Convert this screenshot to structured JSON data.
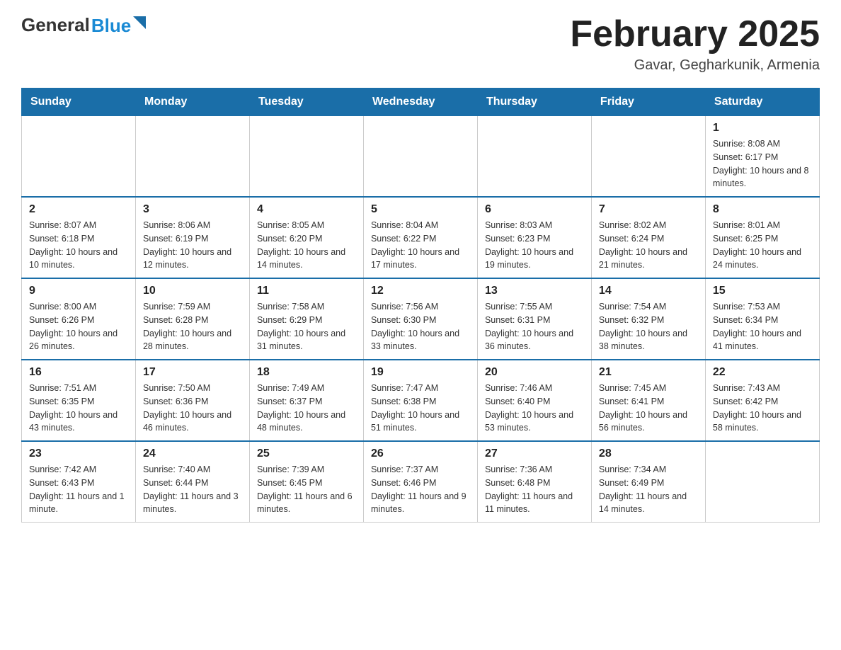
{
  "logo": {
    "general": "General",
    "blue": "Blue"
  },
  "title": "February 2025",
  "subtitle": "Gavar, Gegharkunik, Armenia",
  "days_of_week": [
    "Sunday",
    "Monday",
    "Tuesday",
    "Wednesday",
    "Thursday",
    "Friday",
    "Saturday"
  ],
  "weeks": [
    {
      "days": [
        {
          "number": "",
          "info": ""
        },
        {
          "number": "",
          "info": ""
        },
        {
          "number": "",
          "info": ""
        },
        {
          "number": "",
          "info": ""
        },
        {
          "number": "",
          "info": ""
        },
        {
          "number": "",
          "info": ""
        },
        {
          "number": "1",
          "info": "Sunrise: 8:08 AM\nSunset: 6:17 PM\nDaylight: 10 hours and 8 minutes."
        }
      ]
    },
    {
      "days": [
        {
          "number": "2",
          "info": "Sunrise: 8:07 AM\nSunset: 6:18 PM\nDaylight: 10 hours and 10 minutes."
        },
        {
          "number": "3",
          "info": "Sunrise: 8:06 AM\nSunset: 6:19 PM\nDaylight: 10 hours and 12 minutes."
        },
        {
          "number": "4",
          "info": "Sunrise: 8:05 AM\nSunset: 6:20 PM\nDaylight: 10 hours and 14 minutes."
        },
        {
          "number": "5",
          "info": "Sunrise: 8:04 AM\nSunset: 6:22 PM\nDaylight: 10 hours and 17 minutes."
        },
        {
          "number": "6",
          "info": "Sunrise: 8:03 AM\nSunset: 6:23 PM\nDaylight: 10 hours and 19 minutes."
        },
        {
          "number": "7",
          "info": "Sunrise: 8:02 AM\nSunset: 6:24 PM\nDaylight: 10 hours and 21 minutes."
        },
        {
          "number": "8",
          "info": "Sunrise: 8:01 AM\nSunset: 6:25 PM\nDaylight: 10 hours and 24 minutes."
        }
      ]
    },
    {
      "days": [
        {
          "number": "9",
          "info": "Sunrise: 8:00 AM\nSunset: 6:26 PM\nDaylight: 10 hours and 26 minutes."
        },
        {
          "number": "10",
          "info": "Sunrise: 7:59 AM\nSunset: 6:28 PM\nDaylight: 10 hours and 28 minutes."
        },
        {
          "number": "11",
          "info": "Sunrise: 7:58 AM\nSunset: 6:29 PM\nDaylight: 10 hours and 31 minutes."
        },
        {
          "number": "12",
          "info": "Sunrise: 7:56 AM\nSunset: 6:30 PM\nDaylight: 10 hours and 33 minutes."
        },
        {
          "number": "13",
          "info": "Sunrise: 7:55 AM\nSunset: 6:31 PM\nDaylight: 10 hours and 36 minutes."
        },
        {
          "number": "14",
          "info": "Sunrise: 7:54 AM\nSunset: 6:32 PM\nDaylight: 10 hours and 38 minutes."
        },
        {
          "number": "15",
          "info": "Sunrise: 7:53 AM\nSunset: 6:34 PM\nDaylight: 10 hours and 41 minutes."
        }
      ]
    },
    {
      "days": [
        {
          "number": "16",
          "info": "Sunrise: 7:51 AM\nSunset: 6:35 PM\nDaylight: 10 hours and 43 minutes."
        },
        {
          "number": "17",
          "info": "Sunrise: 7:50 AM\nSunset: 6:36 PM\nDaylight: 10 hours and 46 minutes."
        },
        {
          "number": "18",
          "info": "Sunrise: 7:49 AM\nSunset: 6:37 PM\nDaylight: 10 hours and 48 minutes."
        },
        {
          "number": "19",
          "info": "Sunrise: 7:47 AM\nSunset: 6:38 PM\nDaylight: 10 hours and 51 minutes."
        },
        {
          "number": "20",
          "info": "Sunrise: 7:46 AM\nSunset: 6:40 PM\nDaylight: 10 hours and 53 minutes."
        },
        {
          "number": "21",
          "info": "Sunrise: 7:45 AM\nSunset: 6:41 PM\nDaylight: 10 hours and 56 minutes."
        },
        {
          "number": "22",
          "info": "Sunrise: 7:43 AM\nSunset: 6:42 PM\nDaylight: 10 hours and 58 minutes."
        }
      ]
    },
    {
      "days": [
        {
          "number": "23",
          "info": "Sunrise: 7:42 AM\nSunset: 6:43 PM\nDaylight: 11 hours and 1 minute."
        },
        {
          "number": "24",
          "info": "Sunrise: 7:40 AM\nSunset: 6:44 PM\nDaylight: 11 hours and 3 minutes."
        },
        {
          "number": "25",
          "info": "Sunrise: 7:39 AM\nSunset: 6:45 PM\nDaylight: 11 hours and 6 minutes."
        },
        {
          "number": "26",
          "info": "Sunrise: 7:37 AM\nSunset: 6:46 PM\nDaylight: 11 hours and 9 minutes."
        },
        {
          "number": "27",
          "info": "Sunrise: 7:36 AM\nSunset: 6:48 PM\nDaylight: 11 hours and 11 minutes."
        },
        {
          "number": "28",
          "info": "Sunrise: 7:34 AM\nSunset: 6:49 PM\nDaylight: 11 hours and 14 minutes."
        },
        {
          "number": "",
          "info": ""
        }
      ]
    }
  ]
}
